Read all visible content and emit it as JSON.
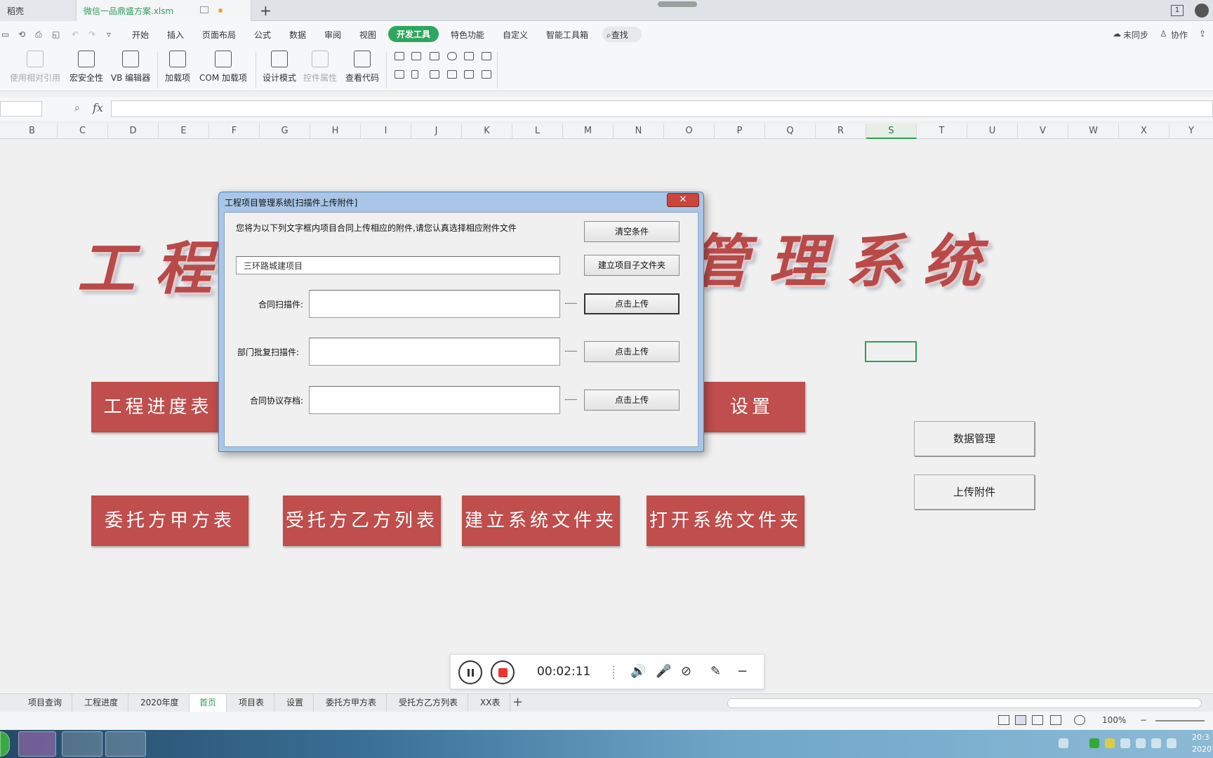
{
  "window": {
    "tabs": [
      {
        "label": "稻壳"
      },
      {
        "label": "微信一品鼎盛方案.xlsm"
      }
    ],
    "new_tab": "+",
    "badge": "1"
  },
  "menu": {
    "items": [
      "开始",
      "插入",
      "页面布局",
      "公式",
      "数据",
      "审阅",
      "视图",
      "开发工具",
      "特色功能",
      "自定义",
      "智能工具箱"
    ],
    "active": "开发工具",
    "search": "查找",
    "sync": "未同步",
    "collab": "协作"
  },
  "ribbon": {
    "buttons": [
      "使用相对引用",
      "宏安全性",
      "VB 编辑器",
      "加载项",
      "COM 加载项",
      "设计模式",
      "控件属性",
      "查看代码"
    ]
  },
  "formula_bar": {
    "fx": "fx",
    "value": ""
  },
  "columns": [
    "B",
    "C",
    "D",
    "E",
    "F",
    "G",
    "H",
    "I",
    "J",
    "K",
    "L",
    "M",
    "N",
    "O",
    "P",
    "Q",
    "R",
    "S",
    "T",
    "U",
    "V",
    "W",
    "X",
    "Y"
  ],
  "selected_column": "S",
  "sheet": {
    "title_left": "工程",
    "title_right": "管理系统",
    "red_buttons_row1": [
      "工程进度表",
      "设置"
    ],
    "red_buttons_row2": [
      "委托方甲方表",
      "受托方乙方列表",
      "建立系统文件夹",
      "打开系统文件夹"
    ],
    "gray_buttons": [
      "数据管理",
      "上传附件"
    ]
  },
  "dialog": {
    "title": "工程项目管理系统[扫描件上传附件]",
    "close": "✕",
    "instruction": "您将为以下列文字框内项目合同上传相应的附件,请您认真选择相应附件文件",
    "project_value": "三环路城建项目",
    "clear_btn": "清空条件",
    "create_folder_btn": "建立项目子文件夹",
    "rows": [
      {
        "label": "合同扫描件:",
        "value": "",
        "dots": "........",
        "button": "点击上传"
      },
      {
        "label": "部门批复扫描件:",
        "value": "",
        "dots": "........",
        "button": "点击上传"
      },
      {
        "label": "合同协议存档:",
        "value": "",
        "dots": "........",
        "button": "点击上传"
      }
    ]
  },
  "recorder": {
    "time": "00:02:11"
  },
  "sheet_tabs": [
    "项目查询",
    "工程进度",
    "2020年度",
    "首页",
    "项目表",
    "设置",
    "委托方甲方表",
    "受托方乙方列表",
    "XX表"
  ],
  "active_sheet": "首页",
  "status": {
    "zoom": "100%"
  },
  "taskbar": {
    "clock_time": "20:3",
    "clock_date": "2020"
  }
}
